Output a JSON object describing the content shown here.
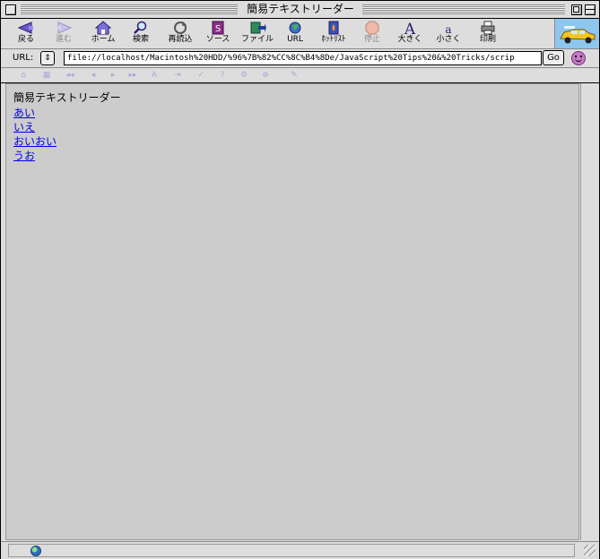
{
  "window": {
    "title": "簡易テキストリーダー"
  },
  "toolbar": {
    "items": [
      {
        "label": "戻る",
        "icon": "back-arrow-icon",
        "enabled": true
      },
      {
        "label": "進む",
        "icon": "forward-arrow-icon",
        "enabled": false
      },
      {
        "label": "ホーム",
        "icon": "home-icon",
        "enabled": true
      },
      {
        "label": "検索",
        "icon": "search-icon",
        "enabled": true
      },
      {
        "label": "再読込",
        "icon": "reload-icon",
        "enabled": true
      },
      {
        "label": "ソース",
        "icon": "source-icon",
        "enabled": true
      },
      {
        "label": "ファイル",
        "icon": "file-icon",
        "enabled": true
      },
      {
        "label": "URL",
        "icon": "globe-icon",
        "enabled": true
      },
      {
        "label": "ﾎｯﾄﾘｽﾄ",
        "icon": "hotlist-icon",
        "enabled": true
      },
      {
        "label": "停止",
        "icon": "stop-icon",
        "enabled": false
      },
      {
        "label": "大きく",
        "icon": "font-larger-icon",
        "enabled": true
      },
      {
        "label": "小さく",
        "icon": "font-smaller-icon",
        "enabled": true
      },
      {
        "label": "印刷",
        "icon": "print-icon",
        "enabled": true
      }
    ]
  },
  "address": {
    "label": "URL:",
    "history_glyph": "⇕",
    "value": "file://localhost/Macintosh%20HDD/%96%7B%82%CC%8C%B4%8De/JavaScript%20Tips%20&%20Tricks/scrip",
    "go_label": "Go"
  },
  "navbar": {
    "icons": [
      "⌂",
      "▦",
      "◂◂",
      "◂",
      "▸",
      "▸▸",
      "A",
      "⇥",
      "✓",
      "?",
      "⚙",
      "⊕",
      "✎"
    ]
  },
  "content": {
    "heading": "簡易テキストリーダー",
    "links": [
      "あい",
      "いえ",
      "おいおい",
      "うお"
    ]
  },
  "status": {
    "text": ""
  },
  "colors": {
    "link": "#0000ee",
    "page_background": "#cccccc",
    "chrome": "#dddddd",
    "disabled_icon": "#b2a4d6"
  }
}
